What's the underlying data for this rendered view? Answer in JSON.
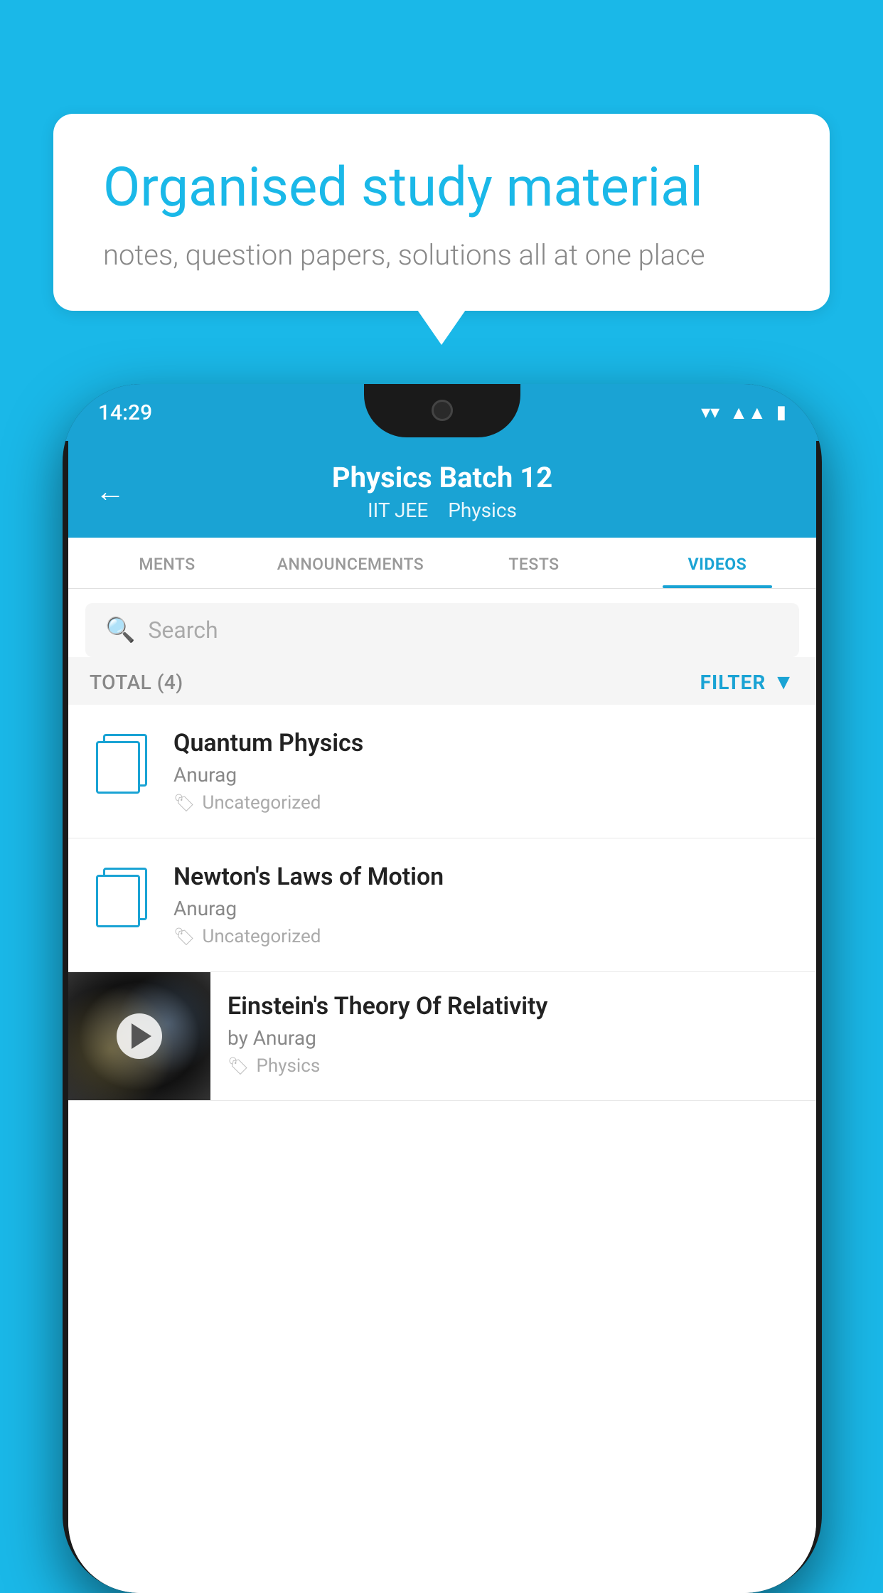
{
  "background_color": "#1ab8e8",
  "hero": {
    "headline": "Organised study material",
    "subheadline": "notes, question papers, solutions all at one place"
  },
  "phone": {
    "status_bar": {
      "time": "14:29",
      "wifi": "▼",
      "signal": "▲",
      "battery": "▮"
    },
    "top_bar": {
      "back_label": "←",
      "title": "Physics Batch 12",
      "subtitle1": "IIT JEE",
      "subtitle2": "Physics"
    },
    "tabs": [
      {
        "label": "MENTS",
        "active": false
      },
      {
        "label": "ANNOUNCEMENTS",
        "active": false
      },
      {
        "label": "TESTS",
        "active": false
      },
      {
        "label": "VIDEOS",
        "active": true
      }
    ],
    "search": {
      "placeholder": "Search"
    },
    "filter_row": {
      "total_label": "TOTAL (4)",
      "filter_label": "FILTER"
    },
    "list_items": [
      {
        "title": "Quantum Physics",
        "author": "Anurag",
        "tag": "Uncategorized",
        "type": "doc"
      },
      {
        "title": "Newton's Laws of Motion",
        "author": "Anurag",
        "tag": "Uncategorized",
        "type": "doc"
      },
      {
        "title": "Einstein's Theory Of Relativity",
        "author": "by Anurag",
        "tag": "Physics",
        "type": "video"
      }
    ]
  }
}
